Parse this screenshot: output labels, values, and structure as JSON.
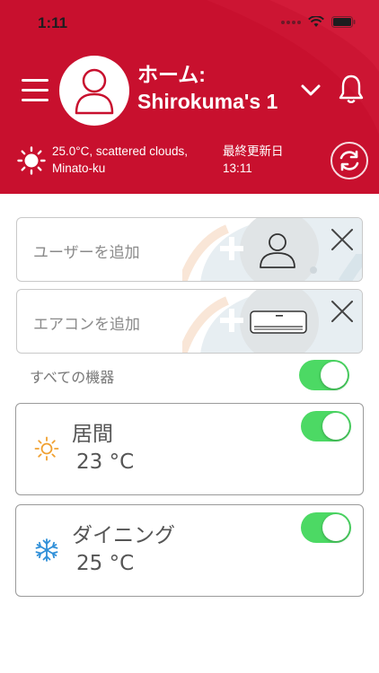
{
  "status_bar": {
    "time": "1:11"
  },
  "header": {
    "title_line1": "ホーム:",
    "title_line2": "Shirokuma's 1",
    "weather_line1": "25.0°C, scattered clouds,",
    "weather_line2": "Minato-ku",
    "updated_label": "最終更新日",
    "updated_time": "13:11",
    "icons": [
      "menu-icon",
      "user-icon",
      "chevron-down-icon",
      "bell-icon",
      "sun-icon",
      "refresh-icon"
    ]
  },
  "add_user": {
    "label": "ユーザーを追加",
    "icons": [
      "plus-icon",
      "user-icon",
      "close-icon"
    ]
  },
  "add_aircon": {
    "label": "エアコンを追加",
    "icons": [
      "plus-icon",
      "air-conditioner-icon",
      "close-icon"
    ]
  },
  "all_devices": {
    "label": "すべての機器",
    "enabled": true
  },
  "rooms": [
    {
      "name": "居間",
      "temperature": "23 °C",
      "mode_icon": "sun-icon",
      "enabled": true
    },
    {
      "name": "ダイニング",
      "temperature": "25 °C",
      "mode_icon": "snowflake-icon",
      "enabled": true
    }
  ],
  "colors": {
    "brand_red": "#c8102e",
    "toggle_on": "#4cd964",
    "heat_orange": "#f0a030",
    "cool_blue": "#2f8fd8"
  }
}
